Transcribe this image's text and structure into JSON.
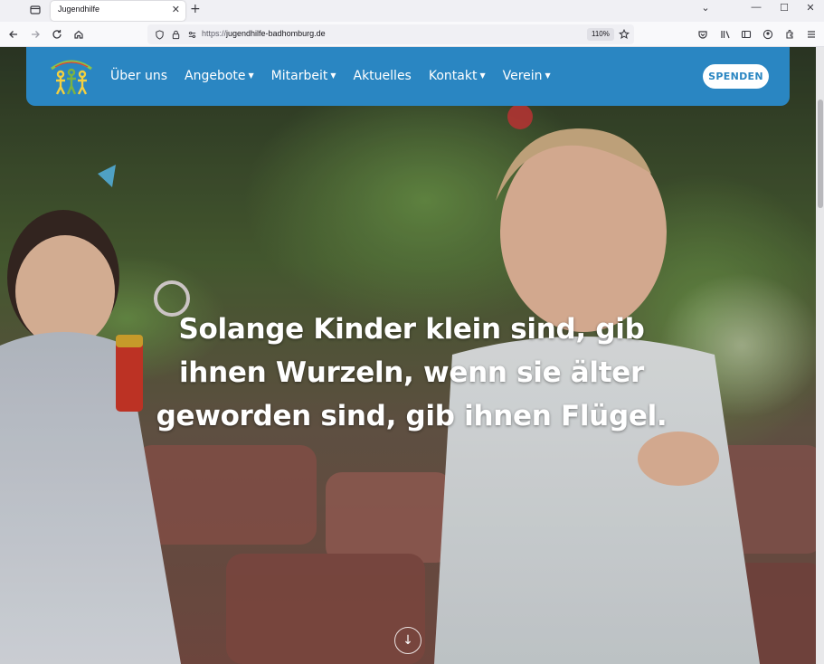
{
  "browser": {
    "tab_title": "Jugendhilfe",
    "tab_close": "✕",
    "new_tab": "+",
    "url_prefix": "https://",
    "url_host": "jugendhilfe-badhomburg.de",
    "zoom": "110%",
    "window_controls": [
      "—",
      "☐",
      "✕"
    ],
    "chevron": "⌄"
  },
  "site": {
    "nav_color": "#2a86c2",
    "menu": [
      {
        "label": "Über uns",
        "has_dropdown": false
      },
      {
        "label": "Angebote",
        "has_dropdown": true
      },
      {
        "label": "Mitarbeit",
        "has_dropdown": true
      },
      {
        "label": "Aktuelles",
        "has_dropdown": false
      },
      {
        "label": "Kontakt",
        "has_dropdown": true
      },
      {
        "label": "Verein",
        "has_dropdown": true
      }
    ],
    "caret": "▼",
    "donate_label": "SPENDEN",
    "headline": "Solange Kinder klein sind, gib ihnen Wurzeln, wenn sie älter geworden sind, gib ihnen Flügel.",
    "scroll_down_icon": "↓"
  }
}
